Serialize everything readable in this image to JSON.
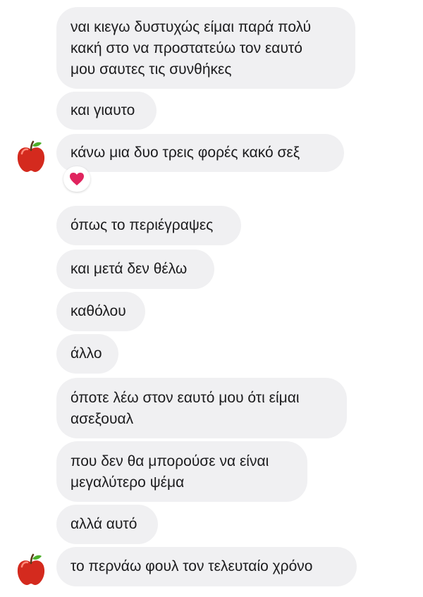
{
  "messages": [
    {
      "lines": [
        "ναι κιεγω δυστυχώς είμαι παρά πολύ",
        "κακή στο να προστατεύω τον εαυτό",
        "μου σαυτες τις συνθήκες"
      ]
    },
    {
      "lines": [
        "και γιαυτο"
      ]
    },
    {
      "lines": [
        "κάνω μια δυο τρεις φορές κακό σεξ"
      ],
      "reaction": "heart-icon",
      "avatar": "apple-icon"
    },
    {
      "lines": [
        "όπως το περιέγραψες"
      ]
    },
    {
      "lines": [
        "και μετά δεν θέλω"
      ]
    },
    {
      "lines": [
        "καθόλου"
      ]
    },
    {
      "lines": [
        "άλλο"
      ]
    },
    {
      "lines": [
        "όποτε λέω στον εαυτό μου ότι είμαι",
        "ασεξουαλ"
      ]
    },
    {
      "lines": [
        "που δεν θα μπορούσε να είναι",
        "μεγαλύτερο ψέμα"
      ]
    },
    {
      "lines": [
        "αλλά αυτό"
      ]
    },
    {
      "lines": [
        "το περνάω φουλ τον τελευταίο χρόνο"
      ],
      "avatar": "apple-icon"
    }
  ],
  "colors": {
    "bubble_bg": "#f0f0f2",
    "text": "#1c1c1e",
    "reaction_heart": "#e0245e",
    "apple": "#d42a1e"
  }
}
